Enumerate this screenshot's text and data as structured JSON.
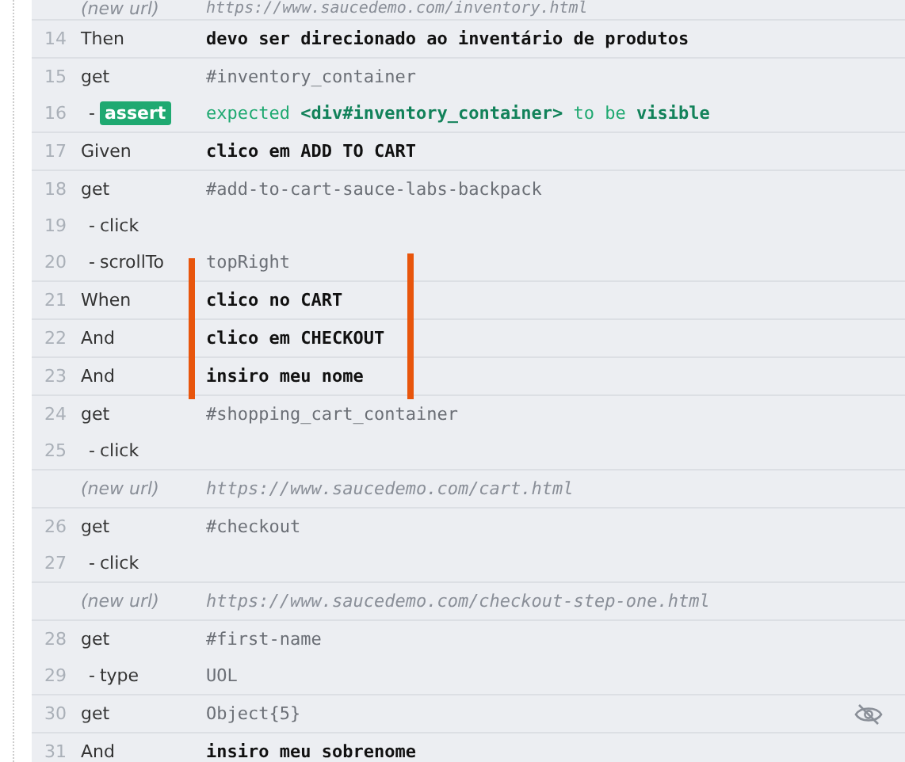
{
  "groups": [
    {
      "rows": [
        {
          "kind": "url",
          "command": "(new url)",
          "message": "https://www.saucedemo.com/inventory.html"
        }
      ]
    },
    {
      "rows": [
        {
          "kind": "step",
          "number": "14",
          "command": "Then",
          "message": "devo ser direcionado ao inventário de produtos"
        }
      ]
    },
    {
      "rows": [
        {
          "kind": "command",
          "number": "15",
          "command": "get",
          "message": "#inventory_container"
        },
        {
          "kind": "assert",
          "number": "16",
          "prefix": "-",
          "command": "assert",
          "message": "expected **<div#inventory_container>** to be **visible**"
        }
      ]
    },
    {
      "rows": [
        {
          "kind": "step",
          "number": "17",
          "command": "Given",
          "message": "clico em ADD TO CART"
        }
      ]
    },
    {
      "rows": [
        {
          "kind": "command",
          "number": "18",
          "command": "get",
          "message": "#add-to-cart-sauce-labs-backpack"
        },
        {
          "kind": "child",
          "number": "19",
          "prefix": "-",
          "command": "click"
        },
        {
          "kind": "child",
          "number": "20",
          "prefix": "-",
          "command": "scrollTo",
          "message": "topRight"
        }
      ]
    },
    {
      "rows": [
        {
          "kind": "step",
          "number": "21",
          "command": "When",
          "message": "clico no CART"
        }
      ]
    },
    {
      "rows": [
        {
          "kind": "step",
          "number": "22",
          "command": "And",
          "message": "clico em CHECKOUT"
        }
      ]
    },
    {
      "rows": [
        {
          "kind": "step",
          "number": "23",
          "command": "And",
          "message": "insiro meu nome"
        }
      ]
    },
    {
      "rows": [
        {
          "kind": "command",
          "number": "24",
          "command": "get",
          "message": "#shopping_cart_container"
        },
        {
          "kind": "child",
          "number": "25",
          "prefix": "-",
          "command": "click"
        }
      ]
    },
    {
      "rows": [
        {
          "kind": "url",
          "command": "(new url)",
          "message": "https://www.saucedemo.com/cart.html"
        }
      ]
    },
    {
      "rows": [
        {
          "kind": "command",
          "number": "26",
          "command": "get",
          "message": "#checkout"
        },
        {
          "kind": "child",
          "number": "27",
          "prefix": "-",
          "command": "click"
        }
      ]
    },
    {
      "rows": [
        {
          "kind": "url",
          "command": "(new url)",
          "message": "https://www.saucedemo.com/checkout-step-one.html"
        }
      ]
    },
    {
      "rows": [
        {
          "kind": "command",
          "number": "28",
          "command": "get",
          "message": "#first-name"
        },
        {
          "kind": "child",
          "number": "29",
          "prefix": "-",
          "command": "type",
          "message": "UOL"
        }
      ]
    },
    {
      "rows": [
        {
          "kind": "command",
          "number": "30",
          "command": "get",
          "message": "Object{5}",
          "hidden": true
        }
      ]
    },
    {
      "rows": [
        {
          "kind": "step",
          "number": "31",
          "command": "And",
          "message": "insiro meu sobrenome"
        }
      ]
    }
  ]
}
